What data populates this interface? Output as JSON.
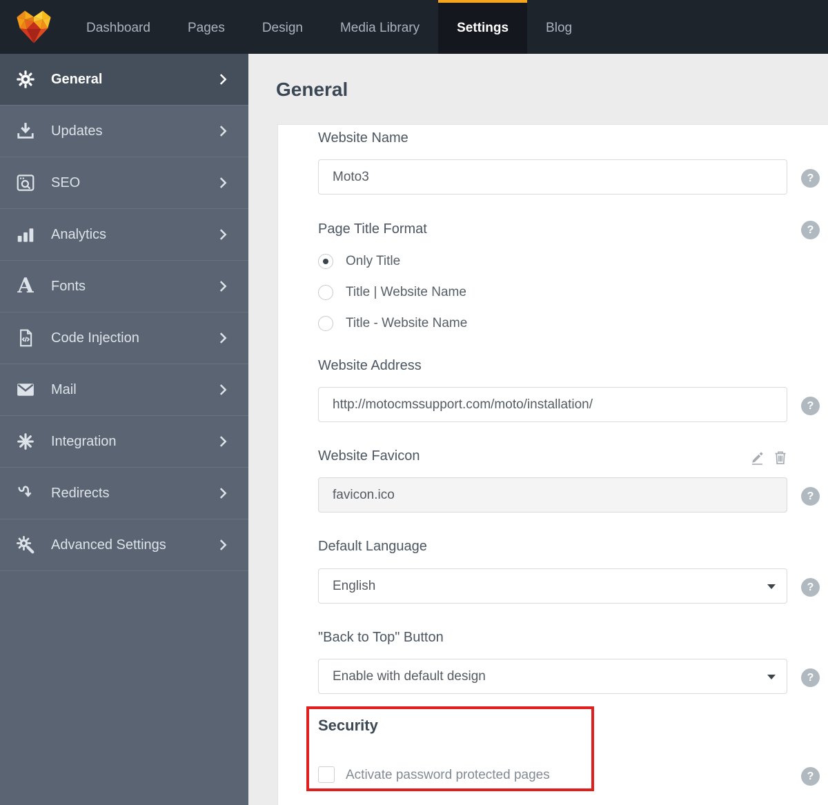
{
  "topnav": {
    "items": [
      "Dashboard",
      "Pages",
      "Design",
      "Media Library",
      "Settings",
      "Blog"
    ],
    "active": "Settings"
  },
  "sidebar": {
    "active": "General",
    "items": [
      {
        "label": "General",
        "icon": "gear-icon"
      },
      {
        "label": "Updates",
        "icon": "download-icon"
      },
      {
        "label": "SEO",
        "icon": "browser-search-icon"
      },
      {
        "label": "Analytics",
        "icon": "bar-chart-icon"
      },
      {
        "label": "Fonts",
        "icon": "serif-a-icon"
      },
      {
        "label": "Code Injection",
        "icon": "code-file-icon"
      },
      {
        "label": "Mail",
        "icon": "envelope-icon"
      },
      {
        "label": "Integration",
        "icon": "asterisk-icon"
      },
      {
        "label": "Redirects",
        "icon": "redirect-arrow-icon"
      },
      {
        "label": "Advanced Settings",
        "icon": "gear-wrench-icon"
      }
    ]
  },
  "page": {
    "title": "General"
  },
  "form": {
    "website_name": {
      "label": "Website Name",
      "value": "Moto3"
    },
    "page_title_format": {
      "label": "Page Title Format",
      "options": [
        "Only Title",
        "Title | Website Name",
        "Title - Website Name"
      ],
      "selected": "Only Title"
    },
    "website_address": {
      "label": "Website Address",
      "value": "http://motocmssupport.com/moto/installation/"
    },
    "website_favicon": {
      "label": "Website Favicon",
      "value": "favicon.ico"
    },
    "default_language": {
      "label": "Default Language",
      "value": "English"
    },
    "back_to_top": {
      "label": "\"Back to Top\" Button",
      "value": "Enable with default design"
    },
    "security": {
      "heading": "Security",
      "checkbox_label": "Activate password protected pages",
      "checked": false
    }
  },
  "ui": {
    "help_glyph": "?",
    "fonts_glyph": "A"
  },
  "colors": {
    "accent_orange": "#f5a51d",
    "annotation_red": "#e11e1e",
    "topbar_bg": "#1e242b",
    "sidebar_bg": "#5a6472",
    "sidebar_active_bg": "#454e5b",
    "help_badge": "#b0b8c0"
  }
}
